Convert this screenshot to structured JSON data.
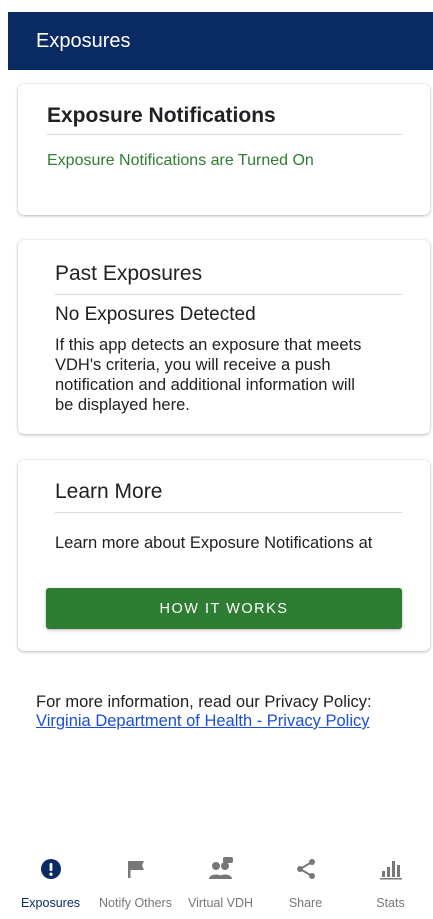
{
  "appbar": {
    "title": "Exposures"
  },
  "exposure_notifications": {
    "title": "Exposure Notifications",
    "status": "Exposure Notifications are Turned On"
  },
  "past_exposures": {
    "title": "Past Exposures",
    "subhead": "No Exposures Detected",
    "body": "If this app detects an exposure that meets VDH's criteria, you will receive a push notification and additional information will be displayed here."
  },
  "learn_more": {
    "title": "Learn More",
    "body": "Learn more about Exposure Notifications at",
    "button": "HOW IT WORKS"
  },
  "privacy": {
    "prefix": "For more information, read our Privacy Policy: ",
    "link": "Virginia Department of Health - Privacy Policy"
  },
  "bottom_nav": {
    "items": [
      {
        "label": "Exposures",
        "icon": "alert-circle-icon",
        "active": true
      },
      {
        "label": "Notify Others",
        "icon": "flag-icon",
        "active": false
      },
      {
        "label": "Virtual VDH",
        "icon": "chat-people-icon",
        "active": false
      },
      {
        "label": "Share",
        "icon": "share-icon",
        "active": false
      },
      {
        "label": "Stats",
        "icon": "bar-chart-icon",
        "active": false
      }
    ]
  },
  "colors": {
    "primary": "#0a2a63",
    "success": "#2e7d32",
    "link": "#1a4fd6"
  }
}
